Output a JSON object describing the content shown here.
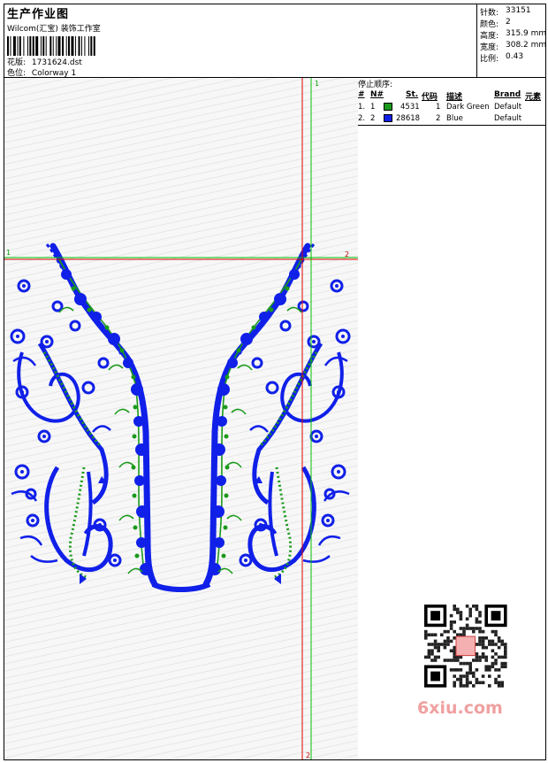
{
  "header": {
    "title": "生产作业图",
    "studio": "Wilcom(汇宝) 装饰工作室",
    "pattern_label": "花版:",
    "pattern_value": "1731624.dst",
    "color_label": "色位:",
    "color_value": "Colorway 1"
  },
  "stats": [
    {
      "label": "针数:",
      "value": "33151"
    },
    {
      "label": "颜色:",
      "value": "2"
    },
    {
      "label": "高度:",
      "value": "315.9 mm"
    },
    {
      "label": "宽度:",
      "value": "308.2 mm"
    },
    {
      "label": "比例:",
      "value": "0.43"
    }
  ],
  "stop_sequence": {
    "title": "停止顺序:",
    "headers": [
      "#",
      "N#",
      "St.",
      "代码",
      "描述",
      "Brand",
      "元素"
    ],
    "rows": [
      {
        "idx": "1.",
        "n": "1",
        "color": "#1a9a1a",
        "st": "4531",
        "code": "1",
        "desc": "Dark Green",
        "brand": "Default"
      },
      {
        "idx": "2.",
        "n": "2",
        "color": "#1020e8",
        "st": "28618",
        "code": "2",
        "desc": "Blue",
        "brand": "Default"
      }
    ]
  },
  "guides": {
    "v_label_top": "1",
    "v_label_bottom": "2",
    "h_label_left": "1",
    "h_label_right": "2"
  },
  "design_colors": {
    "blue": "#1020e8",
    "green": "#1a9a1a"
  },
  "watermark": "6xiu.com"
}
